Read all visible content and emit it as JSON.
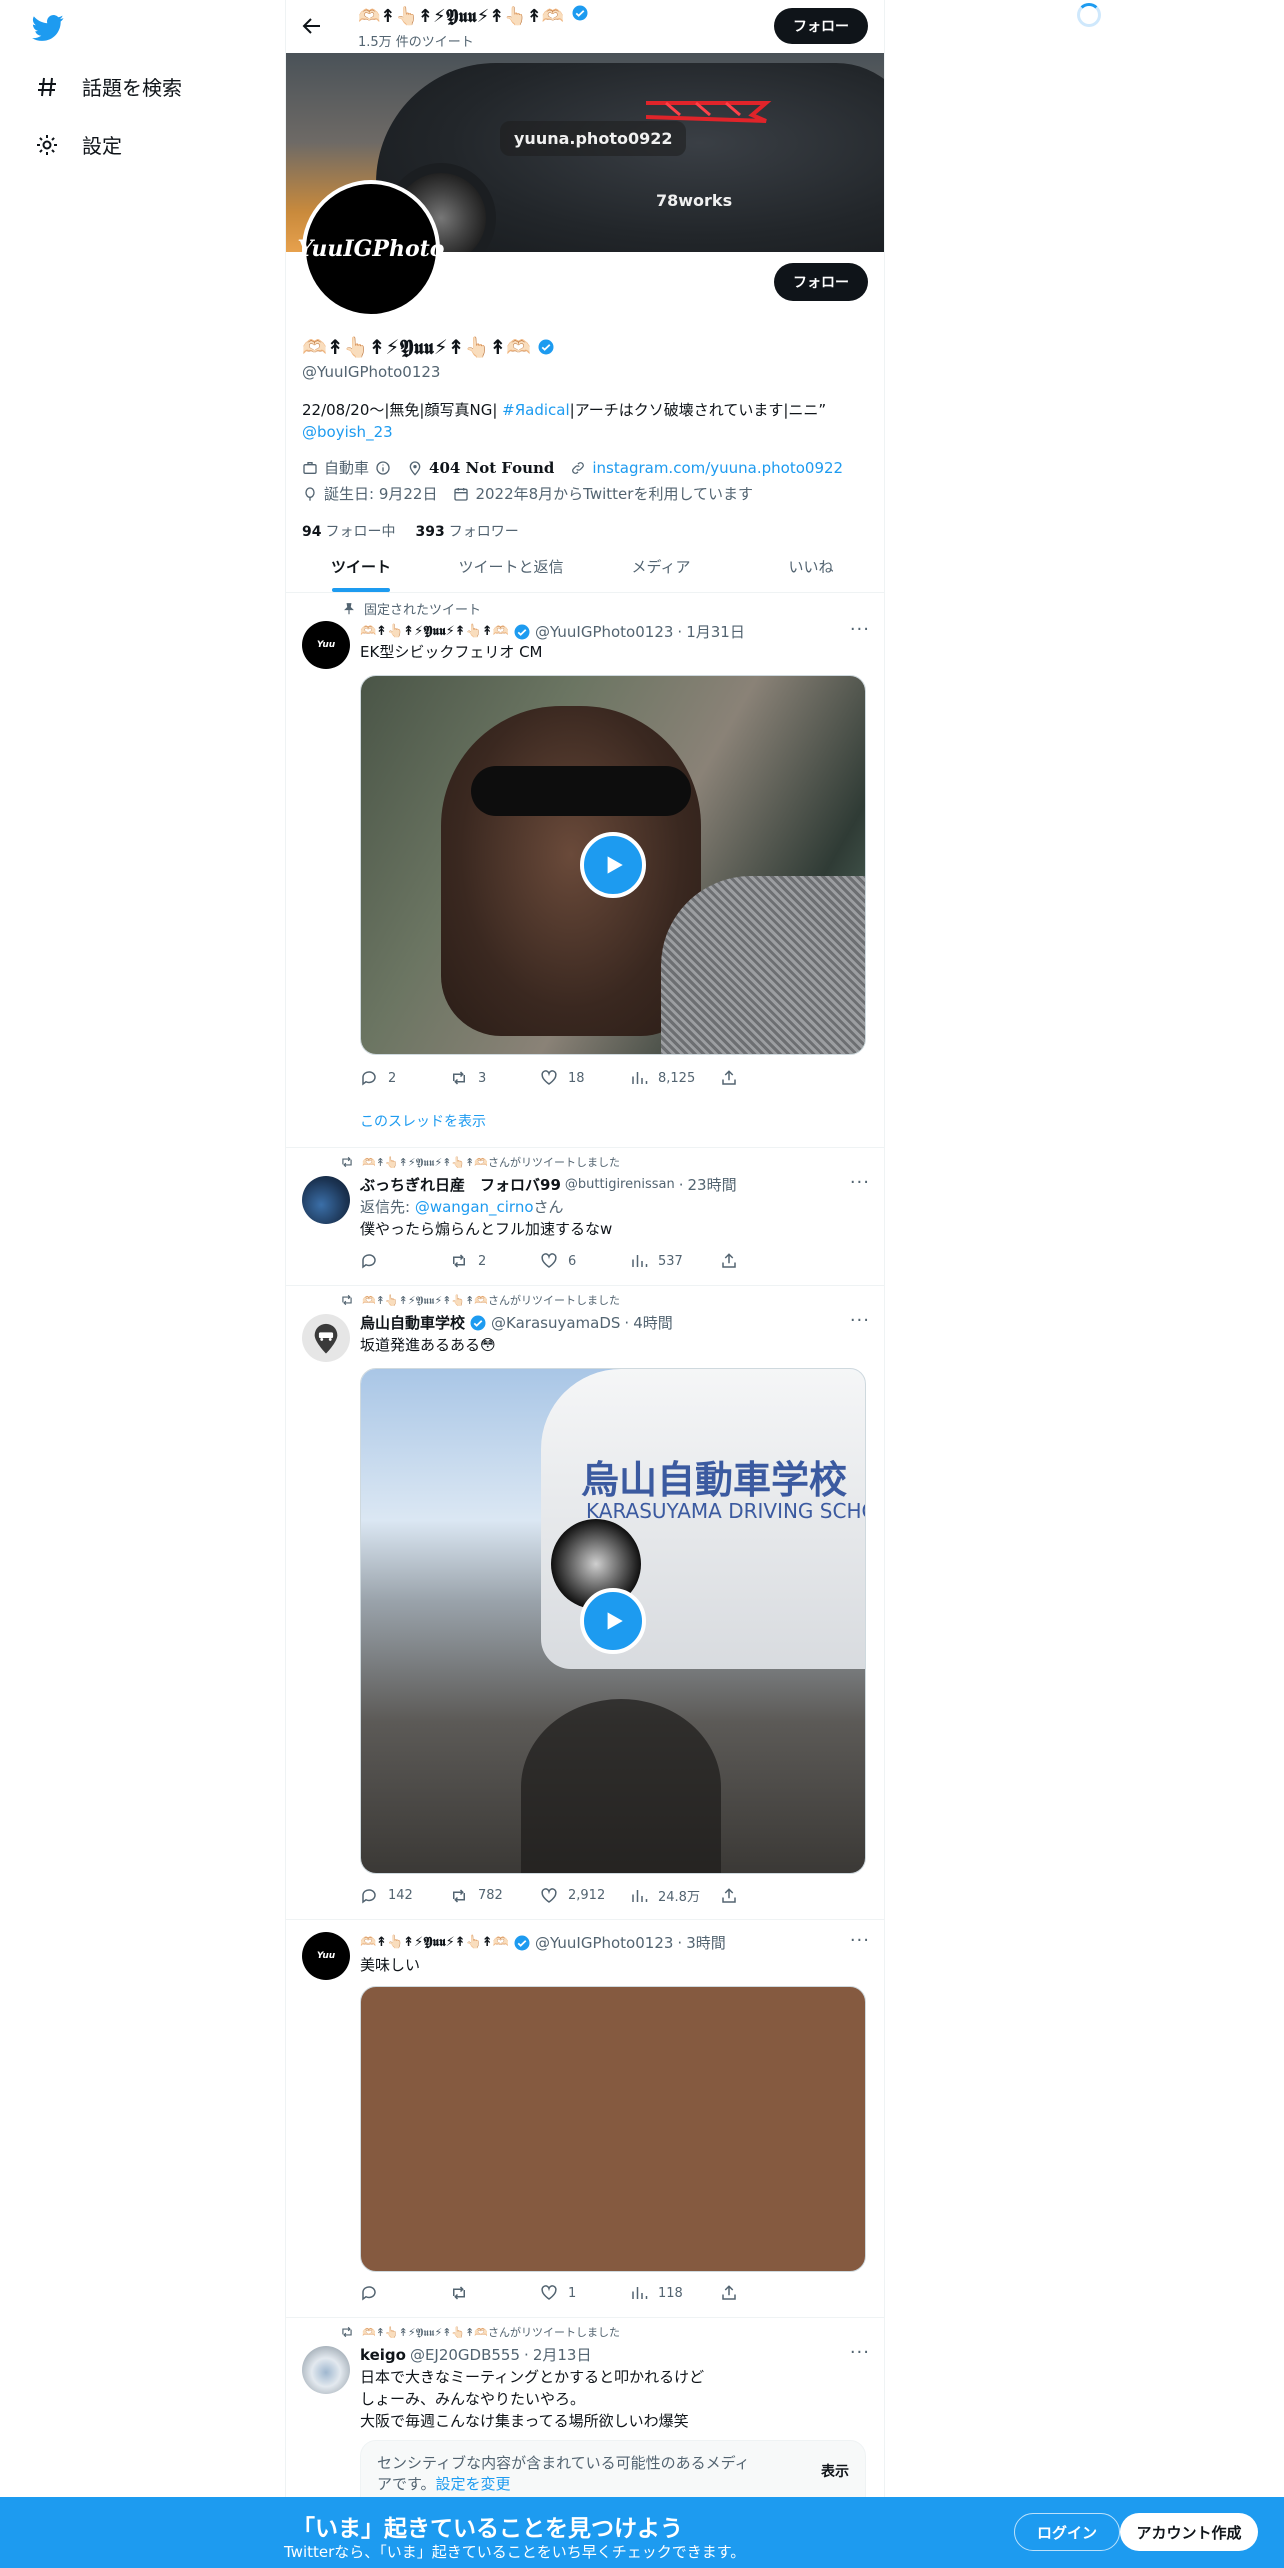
{
  "nav": {
    "explore": "話題を検索",
    "settings": "設定"
  },
  "header": {
    "name": "🫶🏻↟👆🏻↟⚡𝖄𝖚𝖚⚡↟👆🏻↟🫶🏻",
    "tweet_count": "1.5万 件のツイート",
    "follow": "フォロー"
  },
  "banner": {
    "chip1": "yuuna.photo0922",
    "chip2": "78works"
  },
  "profile": {
    "avatar_text": "YuuIGPhoto",
    "name": "🫶🏻↟👆🏻↟⚡𝖄𝖚𝖚⚡↟👆🏻↟🫶🏻",
    "handle": "@YuuIGPhoto0123",
    "follow": "フォロー",
    "bio_pre": "22/08/20〜|無免|顔写真NG| ",
    "bio_tag": "#Яadical",
    "bio_post": "|アーチはクソ破壊されています|ニニ”",
    "bio_mention": "@boyish_23",
    "category": "自動車",
    "location": "𝟒𝟎𝟒 𝐍𝐨𝐭 𝐅𝐨𝐮𝐧𝐝",
    "url": "instagram.com/yuuna.photo0922",
    "birthday": "誕生日: 9月22日",
    "joined": "2022年8月からTwitterを利用しています",
    "following_count": "94",
    "following_label": "フォロー中",
    "followers_count": "393",
    "followers_label": "フォロワー"
  },
  "tabs": [
    "ツイート",
    "ツイートと返信",
    "メディア",
    "いいね"
  ],
  "tweets": [
    {
      "social": "固定されたツイート",
      "name": "🫶🏻↟👆🏻↟⚡𝖄𝖚𝖚⚡↟👆🏻↟🫶🏻",
      "handle": "@YuuIGPhoto0123",
      "time": "1月31日",
      "text": "EK型シビックフェリオ CM",
      "replies": "2",
      "retweets": "3",
      "likes": "18",
      "views": "8,125",
      "thread": "このスレッドを表示"
    },
    {
      "social": "🫶🏻↟👆🏻↟⚡𝖄𝖚𝖚⚡↟👆🏻↟🫶🏻さんがリツイートしました",
      "name": "ぶっちぎれ日産　フォロバ99",
      "handle": "@buttigirenissan",
      "time": "23時間",
      "reply_prefix": "返信先: ",
      "reply_to": "@wangan_cirno",
      "reply_suffix": "さん",
      "text": "僕やったら煽らんとフル加速するなw",
      "replies": "",
      "retweets": "2",
      "likes": "6",
      "views": "537"
    },
    {
      "social": "🫶🏻↟👆🏻↟⚡𝖄𝖚𝖚⚡↟👆🏻↟🫶🏻さんがリツイートしました",
      "name": "烏山自動車学校",
      "handle": "@KarasuyamaDS",
      "time": "4時間",
      "text": "坂道発進あるある😳",
      "media_text1": "烏山自動車学校",
      "media_text2": "KARASUYAMA DRIVING SCHO",
      "replies": "142",
      "retweets": "782",
      "likes": "2,912",
      "views": "24.8万"
    },
    {
      "social": "",
      "name": "🫶🏻↟👆🏻↟⚡𝖄𝖚𝖚⚡↟👆🏻↟🫶🏻",
      "handle": "@YuuIGPhoto0123",
      "time": "3時間",
      "text": "美味しい",
      "replies": "",
      "retweets": "",
      "likes": "1",
      "views": "118"
    },
    {
      "social": "🫶🏻↟👆🏻↟⚡𝖄𝖚𝖚⚡↟👆🏻↟🫶🏻さんがリツイートしました",
      "name": "keigo",
      "handle": "@EJ20GDB555",
      "time": "2月13日",
      "text_lines": [
        "日本で大きなミーティングとかすると叩かれるけど",
        "しょーみ、みんなやりたいやろ。",
        "大阪で毎週こんなけ集まってる場所欲しいわ爆笑"
      ],
      "sensitive_text": "センシティブな内容が含まれている可能性のあるメディアです。",
      "sensitive_link": "設定を変更",
      "show": "表示"
    }
  ],
  "bottom_bar": {
    "title": "「いま」起きていることを見つけよう",
    "subtitle": "Twitterなら、「いま」起きていることをいち早くチェックできます。",
    "login": "ログイン",
    "signup": "アカウント作成"
  },
  "colors": {
    "accent": "#1d9bf0",
    "text": "#0f1419",
    "muted": "#536471",
    "food_media": "#855a40"
  }
}
